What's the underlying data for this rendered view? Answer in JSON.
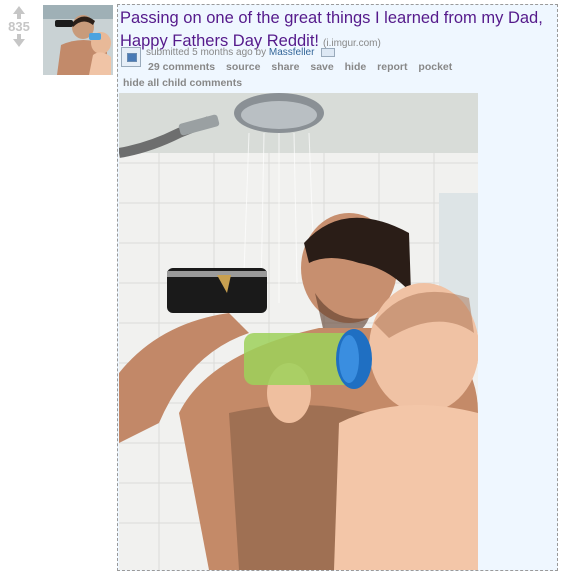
{
  "post": {
    "score": "835",
    "title": "Passing on one of the great things I learned from my Dad, Happy Fathers Day Reddit!",
    "domain": "(i.imgur.com)",
    "tagline_prefix": "submitted 5 months ago by",
    "author": "Massfeller",
    "buttons": [
      {
        "label": "29 comments"
      },
      {
        "label": "source"
      },
      {
        "label": "share"
      },
      {
        "label": "save"
      },
      {
        "label": "hide"
      },
      {
        "label": "report"
      },
      {
        "label": "pocket"
      }
    ],
    "hide_child": "hide all child comments"
  },
  "colors": {
    "title": "#551a8b",
    "entry_bg": "#eff7ff",
    "meta": "#888888",
    "author": "#336699"
  },
  "icons": {
    "upvote": "up-arrow-icon",
    "downvote": "down-arrow-icon",
    "expando": "image-expando-icon",
    "message": "mail-icon"
  }
}
